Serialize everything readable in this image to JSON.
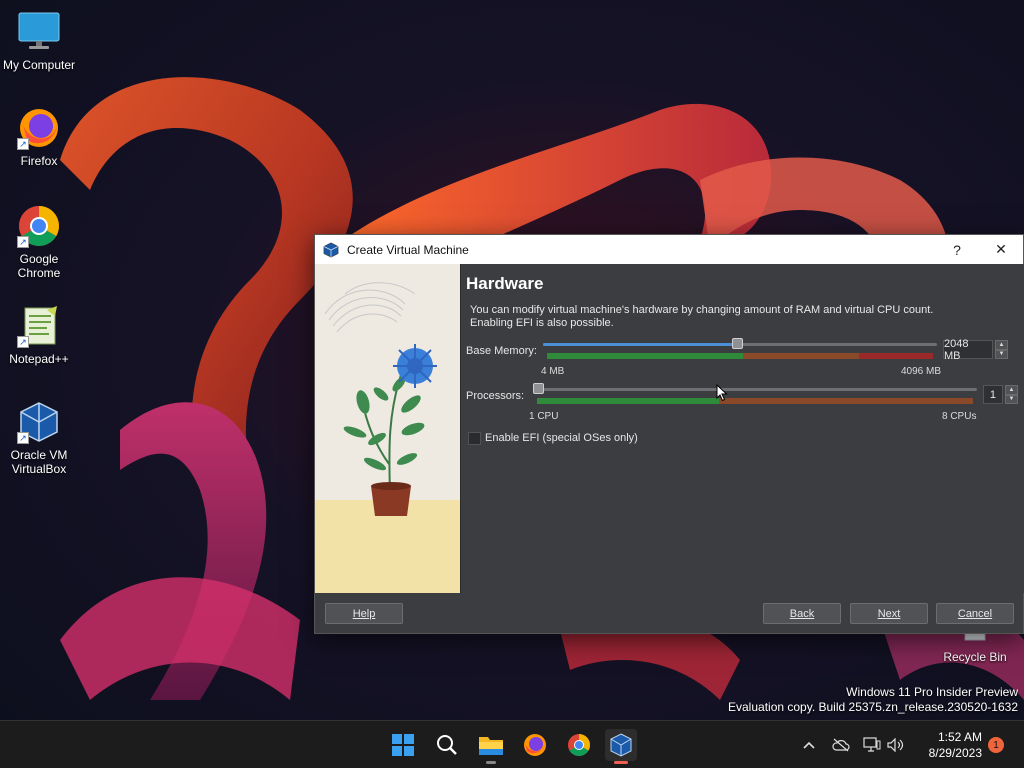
{
  "desktop": {
    "icons": [
      {
        "label": "My Computer"
      },
      {
        "label": "Firefox"
      },
      {
        "label": "Google Chrome"
      },
      {
        "label": "Notepad++"
      },
      {
        "label": "Oracle VM VirtualBox"
      },
      {
        "label": "Recycle Bin"
      }
    ],
    "watermark": {
      "line1": "Windows 11 Pro Insider Preview",
      "line2": "Evaluation copy. Build 25375.zn_release.230520-1632"
    }
  },
  "dialog": {
    "title": "Create Virtual Machine",
    "help_glyph": "?",
    "close_glyph": "✕",
    "heading": "Hardware",
    "description_line1": "You can modify virtual machine's hardware by changing amount of RAM and virtual CPU count.",
    "description_line2": "Enabling EFI is also possible.",
    "memory": {
      "label": "Base Memory:",
      "value": "2048 MB",
      "min_label": "4 MB",
      "max_label": "4096 MB",
      "fraction": 0.5
    },
    "processors": {
      "label": "Processors:",
      "value": "1",
      "min_label": "1 CPU",
      "max_label": "8 CPUs",
      "fraction": 0.0
    },
    "efi": {
      "label": "Enable EFI (special OSes only)",
      "checked": false
    },
    "buttons": {
      "help": "Help",
      "back": "Back",
      "next": "Next",
      "cancel": "Cancel"
    }
  },
  "taskbar": {
    "apps": [
      "start-icon",
      "search-icon",
      "file-explorer-icon",
      "firefox-icon",
      "chrome-icon",
      "virtualbox-icon"
    ],
    "tray": {
      "time": "1:52 AM",
      "date": "8/29/2023",
      "notification_count": "1"
    }
  },
  "colors": {
    "dialog_bg": "#3b3d40",
    "accent_blue": "#4d8fd6",
    "zone_green": "#2f8a3a",
    "zone_orange": "#8a4a2a",
    "zone_red": "#9a2a2a",
    "taskbar_bg": "#1c1c1c"
  }
}
